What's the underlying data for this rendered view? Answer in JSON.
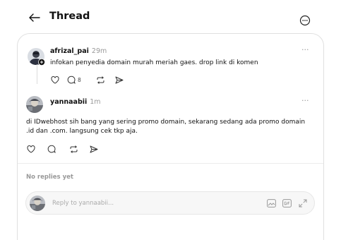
{
  "header": {
    "title": "Thread"
  },
  "parent_post": {
    "username": "afrizal_pai",
    "time": "29m",
    "text": "infokan penyedia domain murah meriah gaes. drop link di komen",
    "reply_count": "8"
  },
  "main_post": {
    "username": "yannaabii",
    "time": "1m",
    "text_line1": "di IDwebhost sih bang yang sering promo domain, sekarang sedang ada promo domain",
    "text_line2": ".id dan .com. langsung cek tkp aja."
  },
  "replies": {
    "empty_label": "No replies yet"
  },
  "reply_input": {
    "placeholder": "Reply to yannaabii..."
  },
  "icons": {
    "back": "arrow-left-icon",
    "menu": "more-circle-icon",
    "like": "heart-icon",
    "comment": "comment-icon",
    "repost": "repost-icon",
    "share": "send-icon",
    "image": "image-icon",
    "gif": "gif-icon",
    "expand": "expand-icon"
  },
  "colors": {
    "accent": "#000000",
    "muted": "#999999",
    "border": "#e0e0e0"
  }
}
